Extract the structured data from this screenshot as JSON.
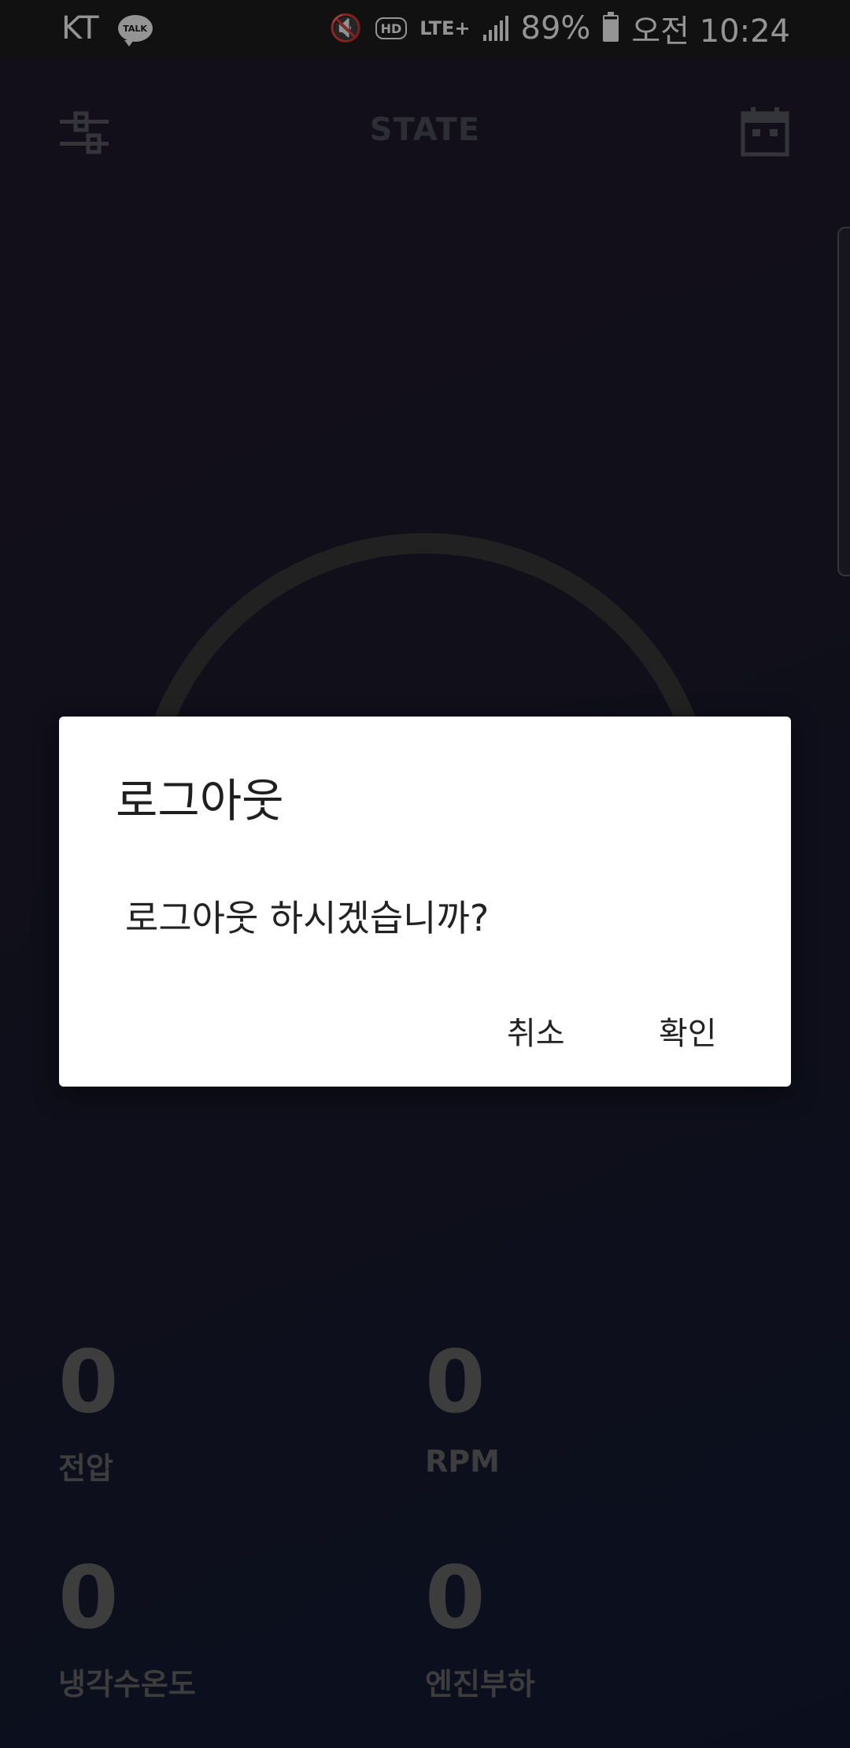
{
  "status_bar": {
    "carrier": "KT",
    "talk_badge": "TALK",
    "hd_label": "HD",
    "lte_label": "LTE+",
    "battery": "89%",
    "time": "오전 10:24"
  },
  "header": {
    "title": "STATE"
  },
  "gauge": {
    "value": "0"
  },
  "metrics": [
    {
      "value": "0",
      "label": "전압"
    },
    {
      "value": "0",
      "label": "RPM"
    },
    {
      "value": "0",
      "label": "냉각수온도"
    },
    {
      "value": "0",
      "label": "엔진부하"
    }
  ],
  "dialog": {
    "title": "로그아웃",
    "message": "로그아웃 하시겠습니까?",
    "cancel_label": "취소",
    "confirm_label": "확인"
  },
  "colors": {
    "bg_top": "#221a2e",
    "bg_bottom": "#141a33",
    "metric_text": "#6a6a6a",
    "gauge_ring": "#3a3a3a"
  }
}
